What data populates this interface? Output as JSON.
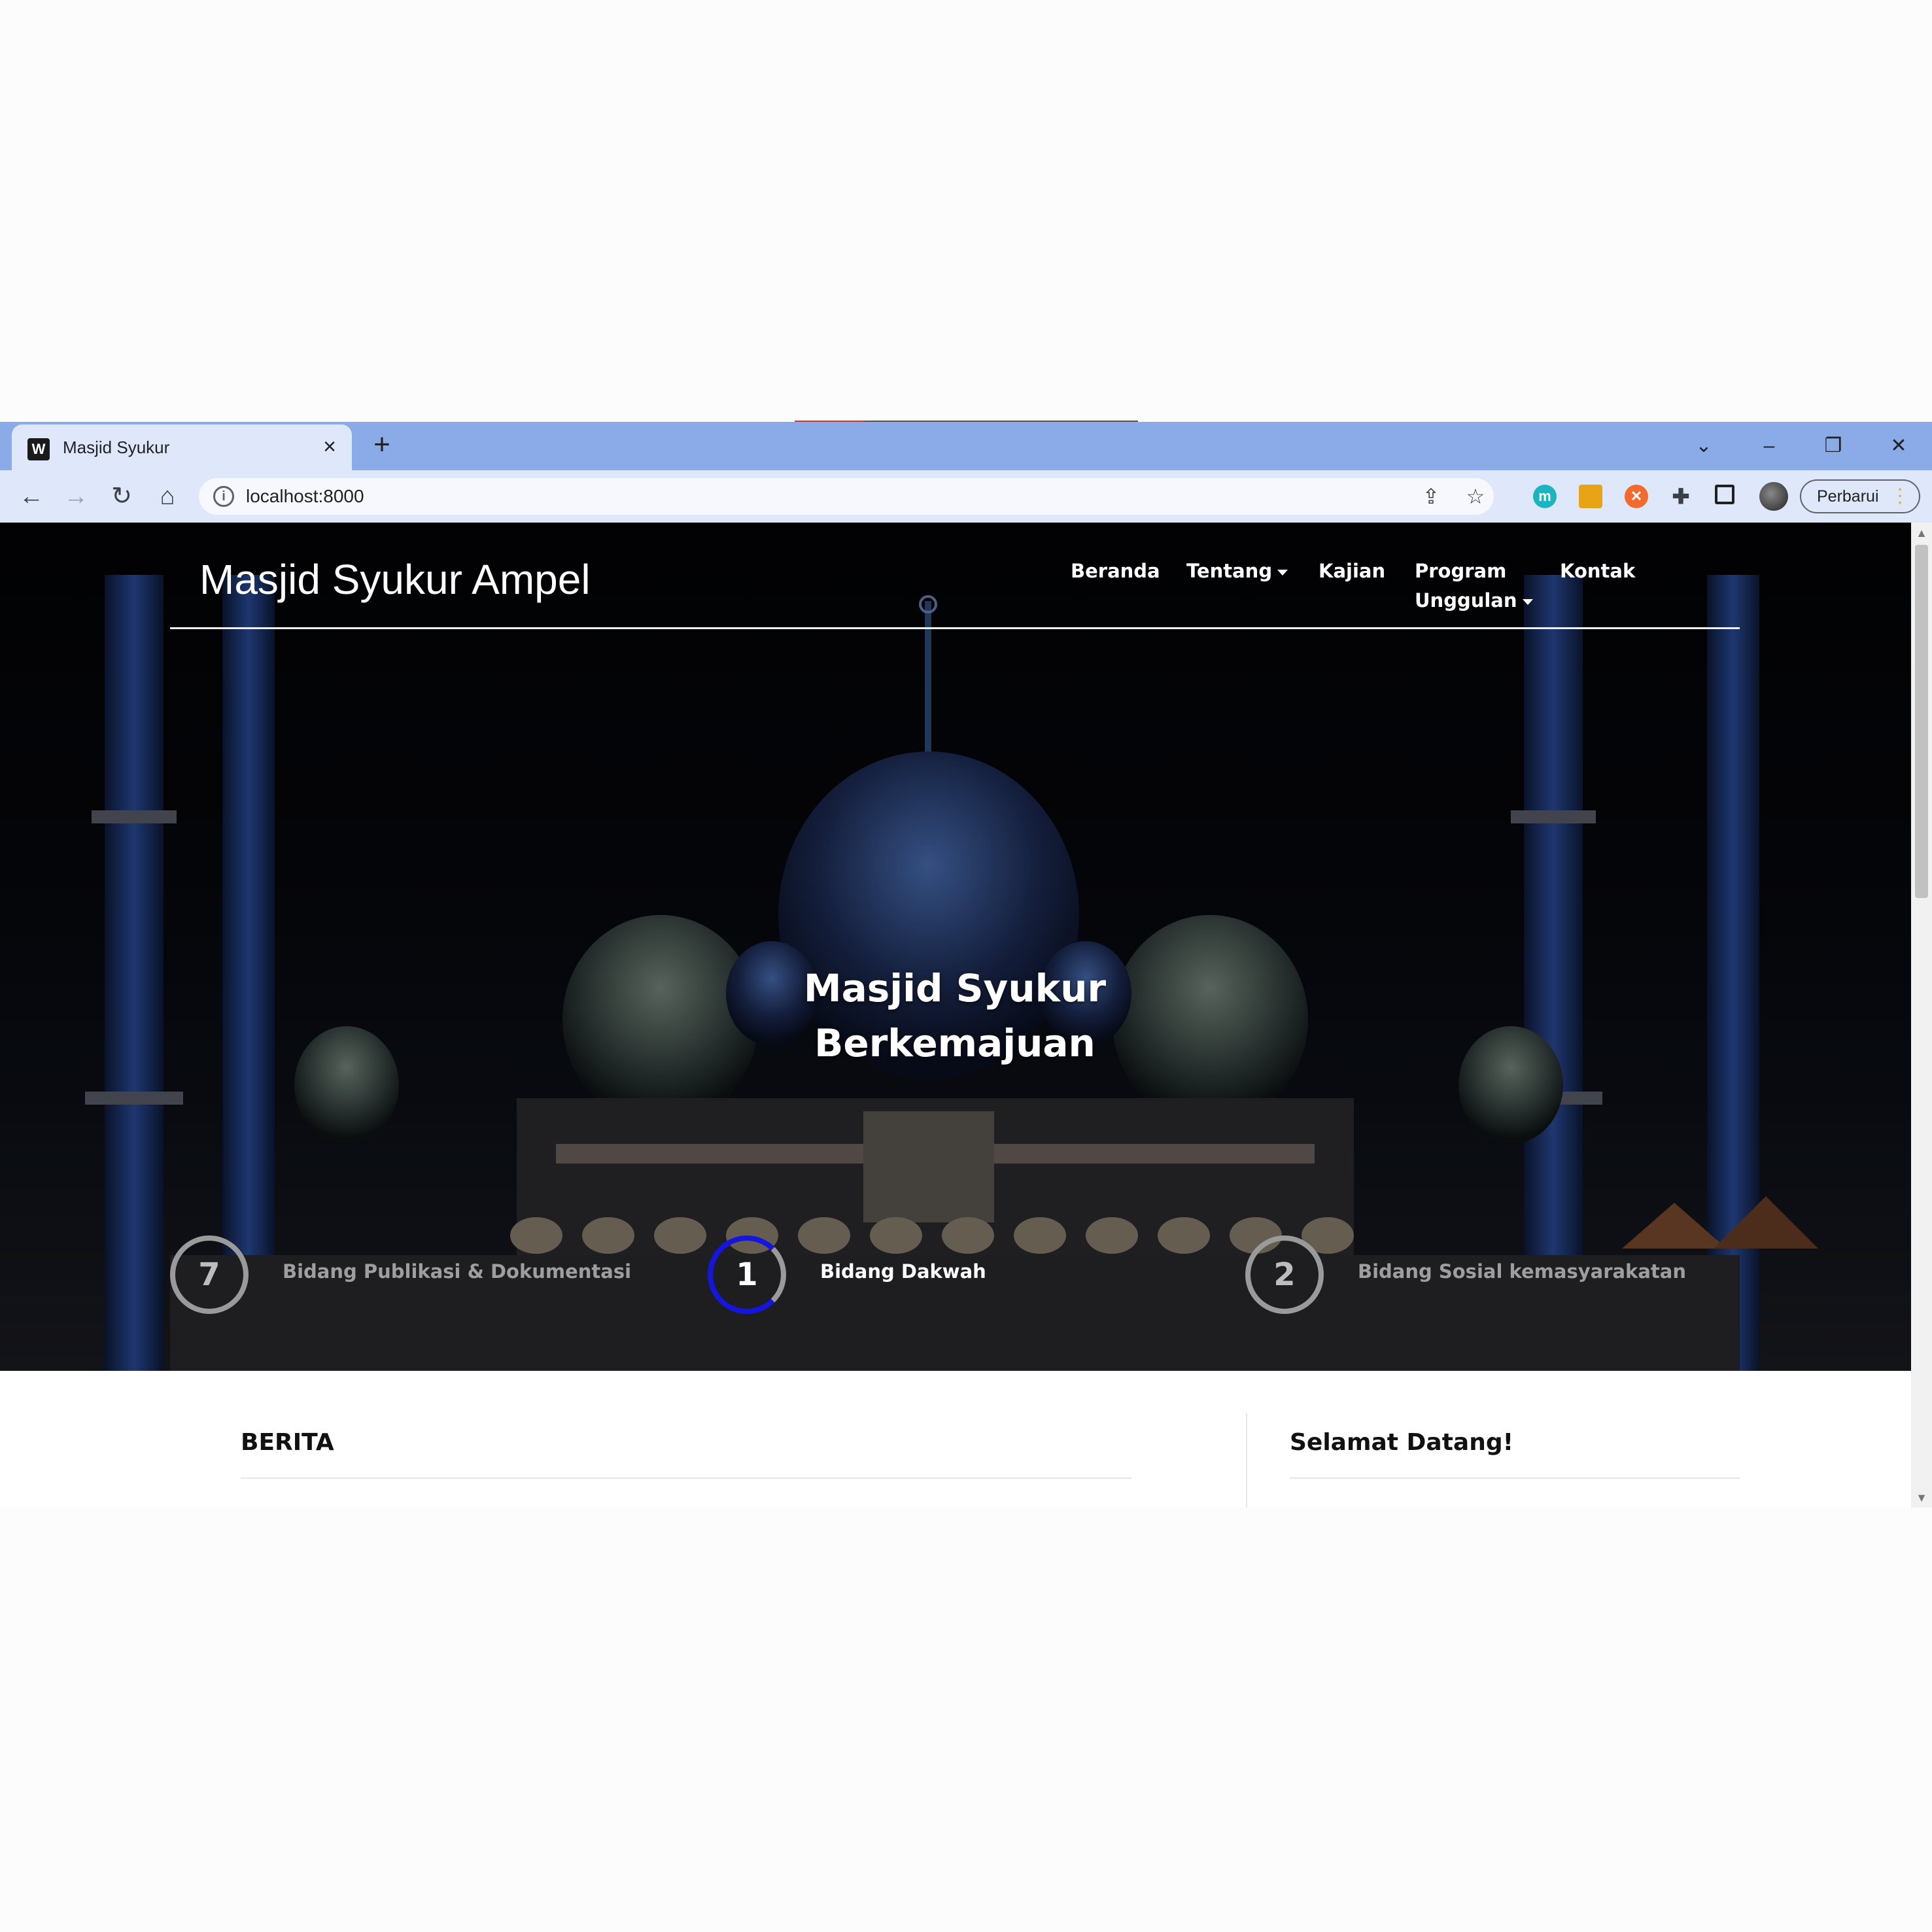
{
  "browser": {
    "tab_title": "Masjid Syukur",
    "tab_favicon_letter": "W",
    "url": "localhost:8000",
    "update_label": "Perbarui",
    "ext_m_letter": "m",
    "ext_colors": {
      "m": "#19b5c0",
      "tag": "#e8a317",
      "orange": "#f26a2e"
    }
  },
  "site": {
    "brand": "Masjid Syukur Ampel",
    "nav": [
      {
        "label": "Beranda"
      },
      {
        "label": "Tentang"
      },
      {
        "label": "Kajian"
      },
      {
        "label": "Program Unggulan",
        "line1": "Program",
        "line2": "Unggulan"
      },
      {
        "label": "Kontak"
      }
    ],
    "hero_title_line1": "Masjid Syukur",
    "hero_title_line2": "Berkemajuan",
    "steps": [
      {
        "number": "7",
        "label": "Bidang Publikasi & Dokumentasi",
        "active": false
      },
      {
        "number": "1",
        "label": "Bidang Dakwah",
        "active": true
      },
      {
        "number": "2",
        "label": "Bidang Sosial kemasyarakatan",
        "active": false
      }
    ],
    "active_step_color": "#1515e0",
    "news_title": "BERITA",
    "welcome_title": "Selamat Datang!"
  }
}
